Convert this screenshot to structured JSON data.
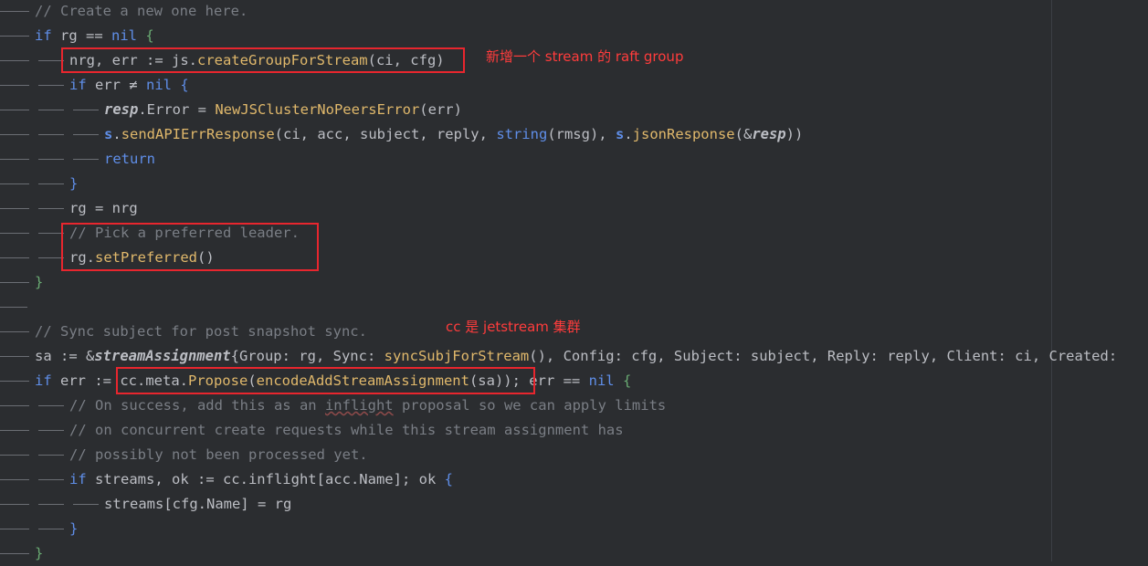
{
  "lines": [
    {
      "indent": 0,
      "tokens": [
        {
          "c": "cm",
          "t": "// Create a new one here."
        }
      ]
    },
    {
      "indent": 0,
      "tokens": [
        {
          "c": "kwb",
          "t": "if "
        },
        {
          "c": "",
          "t": "rg "
        },
        {
          "c": "",
          "t": "== "
        },
        {
          "c": "nil",
          "t": "nil "
        },
        {
          "c": "brg",
          "t": "{"
        }
      ]
    },
    {
      "indent": 1,
      "tokens": [
        {
          "c": "",
          "t": "nrg, err := js."
        },
        {
          "c": "fn",
          "t": "createGroupForStream"
        },
        {
          "c": "",
          "t": "(ci, cfg)"
        }
      ]
    },
    {
      "indent": 1,
      "tokens": [
        {
          "c": "kwb",
          "t": "if "
        },
        {
          "c": "",
          "t": "err "
        },
        {
          "c": "",
          "t": "≠ "
        },
        {
          "c": "nil",
          "t": "nil "
        },
        {
          "c": "br3",
          "t": "{"
        }
      ]
    },
    {
      "indent": 2,
      "tokens": [
        {
          "c": "ty",
          "t": "resp"
        },
        {
          "c": "",
          "t": ".Error = "
        },
        {
          "c": "fn",
          "t": "NewJSClusterNoPeersError"
        },
        {
          "c": "",
          "t": "(err)"
        }
      ]
    },
    {
      "indent": 2,
      "tokens": [
        {
          "c": "rcv",
          "t": "s"
        },
        {
          "c": "",
          "t": "."
        },
        {
          "c": "fn",
          "t": "sendAPIErrResponse"
        },
        {
          "c": "",
          "t": "(ci, acc, subject, reply, "
        },
        {
          "c": "kwb",
          "t": "string"
        },
        {
          "c": "",
          "t": "(rmsg), "
        },
        {
          "c": "rcv",
          "t": "s"
        },
        {
          "c": "",
          "t": "."
        },
        {
          "c": "fn",
          "t": "jsonResponse"
        },
        {
          "c": "",
          "t": "(&"
        },
        {
          "c": "ty",
          "t": "resp"
        },
        {
          "c": "",
          "t": "))"
        }
      ]
    },
    {
      "indent": 2,
      "tokens": [
        {
          "c": "kwb",
          "t": "return"
        }
      ]
    },
    {
      "indent": 1,
      "tokens": [
        {
          "c": "br3",
          "t": "}"
        }
      ]
    },
    {
      "indent": 1,
      "tokens": [
        {
          "c": "",
          "t": "rg = nrg"
        }
      ]
    },
    {
      "indent": 1,
      "tokens": [
        {
          "c": "cm",
          "t": "// Pick a preferred leader."
        }
      ]
    },
    {
      "indent": 1,
      "tokens": [
        {
          "c": "",
          "t": "rg."
        },
        {
          "c": "fn",
          "t": "setPreferred"
        },
        {
          "c": "",
          "t": "()"
        }
      ]
    },
    {
      "indent": 0,
      "tokens": [
        {
          "c": "brg",
          "t": "}"
        }
      ]
    },
    {
      "indent": 0,
      "tokens": []
    },
    {
      "indent": 0,
      "tokens": [
        {
          "c": "cm",
          "t": "// Sync subject for post snapshot sync."
        }
      ]
    },
    {
      "indent": 0,
      "tokens": [
        {
          "c": "",
          "t": "sa := &"
        },
        {
          "c": "ty",
          "t": "streamAssignment"
        },
        {
          "c": "",
          "t": "{Group: rg, Sync: "
        },
        {
          "c": "fn",
          "t": "syncSubjForStream"
        },
        {
          "c": "",
          "t": "(), Config: cfg, Subject: subject, Reply: reply, Client: ci, Created:"
        }
      ]
    },
    {
      "indent": 0,
      "tokens": [
        {
          "c": "kwb",
          "t": "if "
        },
        {
          "c": "",
          "t": "err := "
        },
        {
          "c": "",
          "t": "cc.meta."
        },
        {
          "c": "fn",
          "t": "Propose"
        },
        {
          "c": "",
          "t": "("
        },
        {
          "c": "fn",
          "t": "encodeAddStreamAssignment"
        },
        {
          "c": "",
          "t": "(sa)); err == "
        },
        {
          "c": "nil",
          "t": "nil "
        },
        {
          "c": "brg",
          "t": "{"
        }
      ]
    },
    {
      "indent": 1,
      "tokens": [
        {
          "c": "cm",
          "t": "// On success, add this as an "
        },
        {
          "c": "cm wavy",
          "t": "inflight"
        },
        {
          "c": "cm",
          "t": " proposal so we can apply limits"
        }
      ]
    },
    {
      "indent": 1,
      "tokens": [
        {
          "c": "cm",
          "t": "// on concurrent create requests while this stream assignment has"
        }
      ]
    },
    {
      "indent": 1,
      "tokens": [
        {
          "c": "cm",
          "t": "// possibly not been processed yet."
        }
      ]
    },
    {
      "indent": 1,
      "tokens": [
        {
          "c": "kwb",
          "t": "if "
        },
        {
          "c": "",
          "t": "streams, ok := cc.inflight[acc.Name]; ok "
        },
        {
          "c": "br3",
          "t": "{"
        }
      ]
    },
    {
      "indent": 2,
      "tokens": [
        {
          "c": "",
          "t": "streams[cfg.Name] = rg"
        }
      ]
    },
    {
      "indent": 1,
      "tokens": [
        {
          "c": "br3",
          "t": "}"
        }
      ]
    },
    {
      "indent": 0,
      "tokens": [
        {
          "c": "brg",
          "t": "}"
        }
      ]
    }
  ],
  "annotations": {
    "raft_group": "新增一个 stream 的 raft group",
    "jetstream": "cc 是 jetstream 集群"
  },
  "colors": {
    "background": "#2b2d30",
    "annotation_red": "#e8262e"
  }
}
